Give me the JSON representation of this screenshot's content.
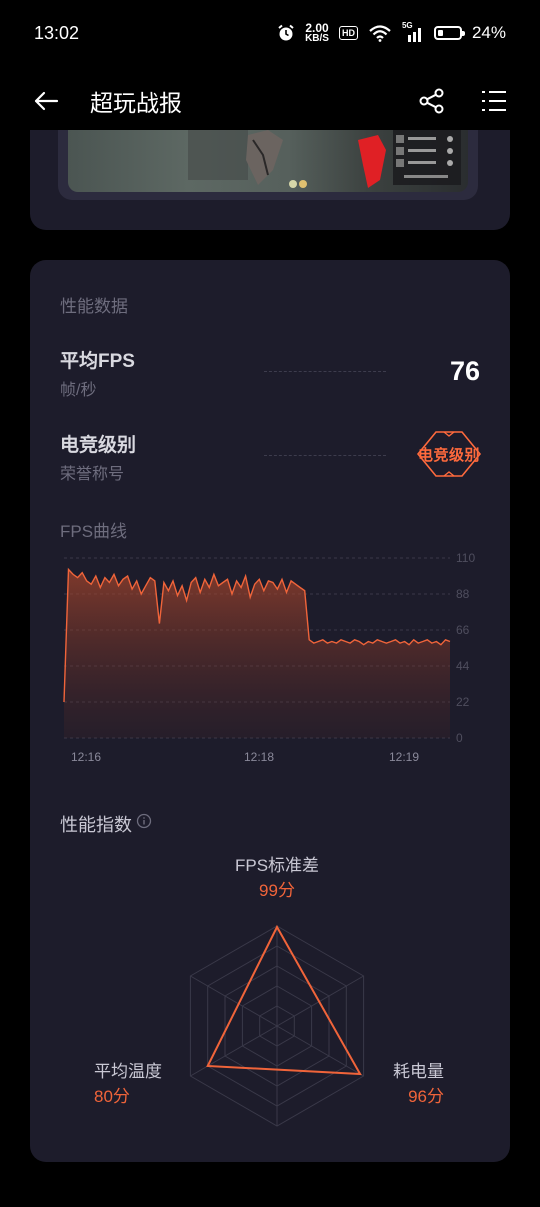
{
  "status_bar": {
    "time": "13:02",
    "net_speed_value": "2.00",
    "net_speed_unit": "KB/S",
    "hd_label": "HD",
    "network_label": "5G",
    "battery_percent": "24%",
    "battery_level": 0.24
  },
  "app_bar": {
    "title": "超玩战报",
    "back_icon": "back-arrow-icon",
    "share_icon": "share-icon",
    "menu_icon": "list-menu-icon"
  },
  "performance": {
    "section_title": "性能数据",
    "avg_fps_label": "平均FPS",
    "avg_fps_unit": "帧/秒",
    "avg_fps_value": "76",
    "esports_label": "电竞级别",
    "esports_sub": "荣誉称号",
    "esports_badge": "电竞级别",
    "fps_curve_title": "FPS曲线",
    "index_title": "性能指数"
  },
  "chart_data": [
    {
      "type": "area",
      "title": "FPS曲线",
      "x_ticks": [
        "12:16",
        "12:18",
        "12:19"
      ],
      "y_ticks": [
        0,
        22,
        44,
        66,
        88,
        110
      ],
      "ylim": [
        0,
        110
      ],
      "grid": true,
      "color": "#f0643a",
      "series": [
        {
          "values": [
            22,
            103,
            100,
            98,
            101,
            96,
            94,
            99,
            92,
            98,
            95,
            100,
            93,
            97,
            99,
            91,
            96,
            88,
            93,
            98,
            96,
            70,
            95,
            90,
            96,
            87,
            93,
            84,
            95,
            98,
            89,
            97,
            92,
            100,
            93,
            95,
            97,
            88,
            96,
            92,
            99,
            86,
            94,
            97,
            90,
            96,
            95,
            91,
            97,
            89,
            96,
            94,
            92,
            90,
            60,
            58,
            59,
            60,
            58,
            59,
            58,
            60,
            59,
            58,
            60,
            59,
            57,
            59,
            58,
            60,
            59,
            58,
            59,
            60,
            58,
            59,
            57,
            60,
            58,
            59,
            60,
            58,
            59,
            57,
            60,
            59
          ]
        }
      ]
    },
    {
      "type": "radar",
      "title": "性能指数",
      "axes": [
        {
          "label": "FPS标准差",
          "score_text": "99分",
          "value": 99
        },
        {
          "label": "耗电量",
          "score_text": "96分",
          "value": 96
        },
        {
          "label": "平均温度",
          "score_text": "80分",
          "value": 80
        }
      ],
      "max": 100,
      "color": "#f0643a"
    }
  ]
}
